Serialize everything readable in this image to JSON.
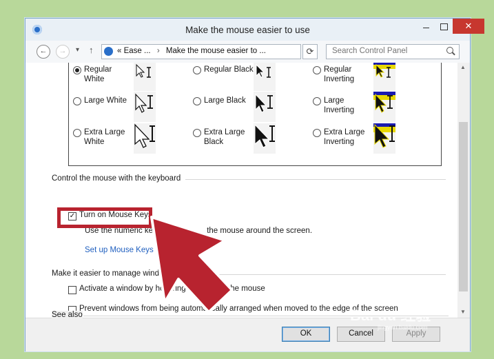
{
  "window": {
    "title": "Make the mouse easier to use",
    "controls": {
      "minimize": "",
      "maximize": "",
      "close": "✕"
    }
  },
  "nav": {
    "back": "←",
    "forward": "→",
    "recent": "▾",
    "up": "↑",
    "breadcrumb": [
      "«",
      "Ease ...",
      "›",
      "Make the mouse easier to ..."
    ],
    "address_dropdown": "▾",
    "refresh": "⟳",
    "search_placeholder": "Search Control Panel"
  },
  "pointer_schemes": [
    {
      "label": "Regular White",
      "line1": "Regular",
      "line2": "White",
      "selected": true
    },
    {
      "label": "Regular Black",
      "line1": "Regular Black",
      "line2": "",
      "selected": false
    },
    {
      "label": "Regular Inverting",
      "line1": "Regular",
      "line2": "Inverting",
      "selected": false
    },
    {
      "label": "Large White",
      "line1": "Large White",
      "line2": "",
      "selected": false
    },
    {
      "label": "Large Black",
      "line1": "Large Black",
      "line2": "",
      "selected": false
    },
    {
      "label": "Large Inverting",
      "line1": "Large",
      "line2": "Inverting",
      "selected": false
    },
    {
      "label": "Extra Large White",
      "line1": "Extra Large",
      "line2": "White",
      "selected": false
    },
    {
      "label": "Extra Large Black",
      "line1": "Extra Large",
      "line2": "Black",
      "selected": false
    },
    {
      "label": "Extra Large Inverting",
      "line1": "Extra Large",
      "line2": "Inverting",
      "selected": false
    }
  ],
  "keyboard_section": {
    "heading": "Control the mouse with the keyboard",
    "mouse_keys_label": "Turn on Mouse Keys",
    "mouse_keys_checked": true,
    "description_start": "Use the numeric keyp",
    "description_end": "the mouse around the screen.",
    "setup_link": "Set up Mouse Keys"
  },
  "windows_section": {
    "heading": "Make it easier to manage windo",
    "activate_label": "Activate a window by hovering over it with the mouse",
    "activate_checked": false,
    "prevent_label": "Prevent windows from being automatically arranged when moved to the edge of the screen",
    "prevent_checked": false
  },
  "see_also": {
    "heading": "See also"
  },
  "footer": {
    "ok": "OK",
    "cancel": "Cancel",
    "apply": "Apply"
  },
  "watermark": {
    "text": "Bai du 经验",
    "sub": "jingyan.baidu.com"
  },
  "colors": {
    "highlight": "#b8232f",
    "link": "#1f5fbf",
    "titlebar": "#e9f0f6",
    "close": "#c7372f"
  }
}
